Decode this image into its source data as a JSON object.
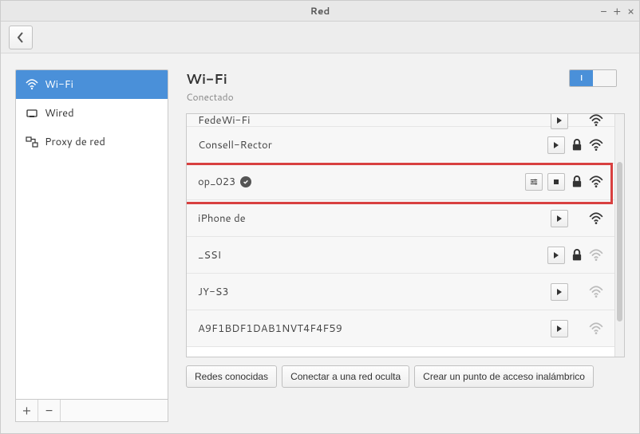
{
  "window": {
    "title": "Red"
  },
  "sidebar": {
    "items": [
      {
        "label": "Wi-Fi"
      },
      {
        "label": "Wired"
      },
      {
        "label": "Proxy de red"
      }
    ]
  },
  "header": {
    "title": "Wi-Fi",
    "status": "Conectado",
    "switch_on_label": "I"
  },
  "networks": [
    {
      "ssid": "FedeWi-Fi",
      "secure": false,
      "connected": false,
      "signal": "strong",
      "partial": true
    },
    {
      "ssid": "Consell-Rector",
      "secure": true,
      "connected": false,
      "signal": "strong"
    },
    {
      "ssid": "op_023",
      "secure": true,
      "connected": true,
      "signal": "strong",
      "highlighted": true
    },
    {
      "ssid": "iPhone de",
      "secure": false,
      "connected": false,
      "signal": "strong"
    },
    {
      "ssid": "_SSI",
      "secure": true,
      "connected": false,
      "signal": "weak"
    },
    {
      "ssid": "JY-S3",
      "secure": false,
      "connected": false,
      "signal": "weak"
    },
    {
      "ssid": "A9F1BDF1DAB1NVT4F4F59",
      "secure": false,
      "connected": false,
      "signal": "weak"
    }
  ],
  "buttons": {
    "known": "Redes conocidas",
    "hidden": "Conectar a una red oculta",
    "hotspot": "Crear un punto de acceso inalámbrico"
  }
}
